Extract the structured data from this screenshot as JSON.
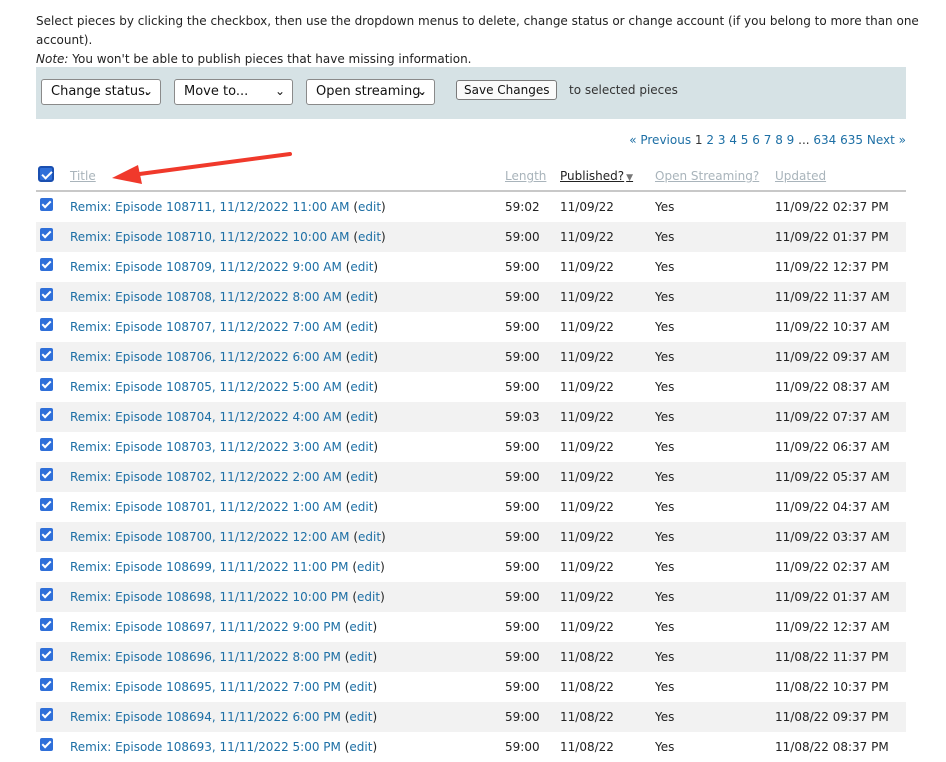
{
  "intro": {
    "line1": "Select pieces by clicking the checkbox, then use the dropdown menus to delete, change status or change account (if you belong to more than one account).",
    "note_label": "Note:",
    "note_text": " You won't be able to publish pieces that have missing information."
  },
  "toolbar": {
    "status_select": "Change status.",
    "move_select": "Move to...",
    "streaming_select": "Open streaming.",
    "save_label": "Save Changes",
    "suffix": "to selected pieces"
  },
  "pager": {
    "previous": "« Previous",
    "current": "1",
    "pages": [
      "2",
      "3",
      "4",
      "5",
      "6",
      "7",
      "8",
      "9"
    ],
    "ellipsis": "...",
    "last_pages": [
      "634",
      "635"
    ],
    "next": "Next »"
  },
  "columns": {
    "title": "Title",
    "length": "Length",
    "published": "Published?",
    "open_streaming": "Open Streaming?",
    "updated": "Updated"
  },
  "colors": {
    "link": "#1d6fa5",
    "accent": "#2f6fd9",
    "arrow": "#f0392b",
    "toolbar_bg": "#d6e2e5"
  },
  "rows": [
    {
      "title": "Remix: Episode 108711, 11/12/2022 11:00 AM",
      "edit": "edit",
      "length": "59:02",
      "published": "11/09/22",
      "open_streaming": "Yes",
      "updated": "11/09/22 02:37 PM"
    },
    {
      "title": "Remix: Episode 108710, 11/12/2022 10:00 AM",
      "edit": "edit",
      "length": "59:00",
      "published": "11/09/22",
      "open_streaming": "Yes",
      "updated": "11/09/22 01:37 PM"
    },
    {
      "title": "Remix: Episode 108709, 11/12/2022 9:00 AM",
      "edit": "edit",
      "length": "59:00",
      "published": "11/09/22",
      "open_streaming": "Yes",
      "updated": "11/09/22 12:37 PM"
    },
    {
      "title": "Remix: Episode 108708, 11/12/2022 8:00 AM",
      "edit": "edit",
      "length": "59:00",
      "published": "11/09/22",
      "open_streaming": "Yes",
      "updated": "11/09/22 11:37 AM"
    },
    {
      "title": "Remix: Episode 108707, 11/12/2022 7:00 AM",
      "edit": "edit",
      "length": "59:00",
      "published": "11/09/22",
      "open_streaming": "Yes",
      "updated": "11/09/22 10:37 AM"
    },
    {
      "title": "Remix: Episode 108706, 11/12/2022 6:00 AM",
      "edit": "edit",
      "length": "59:00",
      "published": "11/09/22",
      "open_streaming": "Yes",
      "updated": "11/09/22 09:37 AM"
    },
    {
      "title": "Remix: Episode 108705, 11/12/2022 5:00 AM",
      "edit": "edit",
      "length": "59:00",
      "published": "11/09/22",
      "open_streaming": "Yes",
      "updated": "11/09/22 08:37 AM"
    },
    {
      "title": "Remix: Episode 108704, 11/12/2022 4:00 AM",
      "edit": "edit",
      "length": "59:03",
      "published": "11/09/22",
      "open_streaming": "Yes",
      "updated": "11/09/22 07:37 AM"
    },
    {
      "title": "Remix: Episode 108703, 11/12/2022 3:00 AM",
      "edit": "edit",
      "length": "59:00",
      "published": "11/09/22",
      "open_streaming": "Yes",
      "updated": "11/09/22 06:37 AM"
    },
    {
      "title": "Remix: Episode 108702, 11/12/2022 2:00 AM",
      "edit": "edit",
      "length": "59:00",
      "published": "11/09/22",
      "open_streaming": "Yes",
      "updated": "11/09/22 05:37 AM"
    },
    {
      "title": "Remix: Episode 108701, 11/12/2022 1:00 AM",
      "edit": "edit",
      "length": "59:00",
      "published": "11/09/22",
      "open_streaming": "Yes",
      "updated": "11/09/22 04:37 AM"
    },
    {
      "title": "Remix: Episode 108700, 11/12/2022 12:00 AM",
      "edit": "edit",
      "length": "59:00",
      "published": "11/09/22",
      "open_streaming": "Yes",
      "updated": "11/09/22 03:37 AM"
    },
    {
      "title": "Remix: Episode 108699, 11/11/2022 11:00 PM",
      "edit": "edit",
      "length": "59:00",
      "published": "11/09/22",
      "open_streaming": "Yes",
      "updated": "11/09/22 02:37 AM"
    },
    {
      "title": "Remix: Episode 108698, 11/11/2022 10:00 PM",
      "edit": "edit",
      "length": "59:00",
      "published": "11/09/22",
      "open_streaming": "Yes",
      "updated": "11/09/22 01:37 AM"
    },
    {
      "title": "Remix: Episode 108697, 11/11/2022 9:00 PM",
      "edit": "edit",
      "length": "59:00",
      "published": "11/09/22",
      "open_streaming": "Yes",
      "updated": "11/09/22 12:37 AM"
    },
    {
      "title": "Remix: Episode 108696, 11/11/2022 8:00 PM",
      "edit": "edit",
      "length": "59:00",
      "published": "11/08/22",
      "open_streaming": "Yes",
      "updated": "11/08/22 11:37 PM"
    },
    {
      "title": "Remix: Episode 108695, 11/11/2022 7:00 PM",
      "edit": "edit",
      "length": "59:00",
      "published": "11/08/22",
      "open_streaming": "Yes",
      "updated": "11/08/22 10:37 PM"
    },
    {
      "title": "Remix: Episode 108694, 11/11/2022 6:00 PM",
      "edit": "edit",
      "length": "59:00",
      "published": "11/08/22",
      "open_streaming": "Yes",
      "updated": "11/08/22 09:37 PM"
    },
    {
      "title": "Remix: Episode 108693, 11/11/2022 5:00 PM",
      "edit": "edit",
      "length": "59:00",
      "published": "11/08/22",
      "open_streaming": "Yes",
      "updated": "11/08/22 08:37 PM"
    }
  ]
}
